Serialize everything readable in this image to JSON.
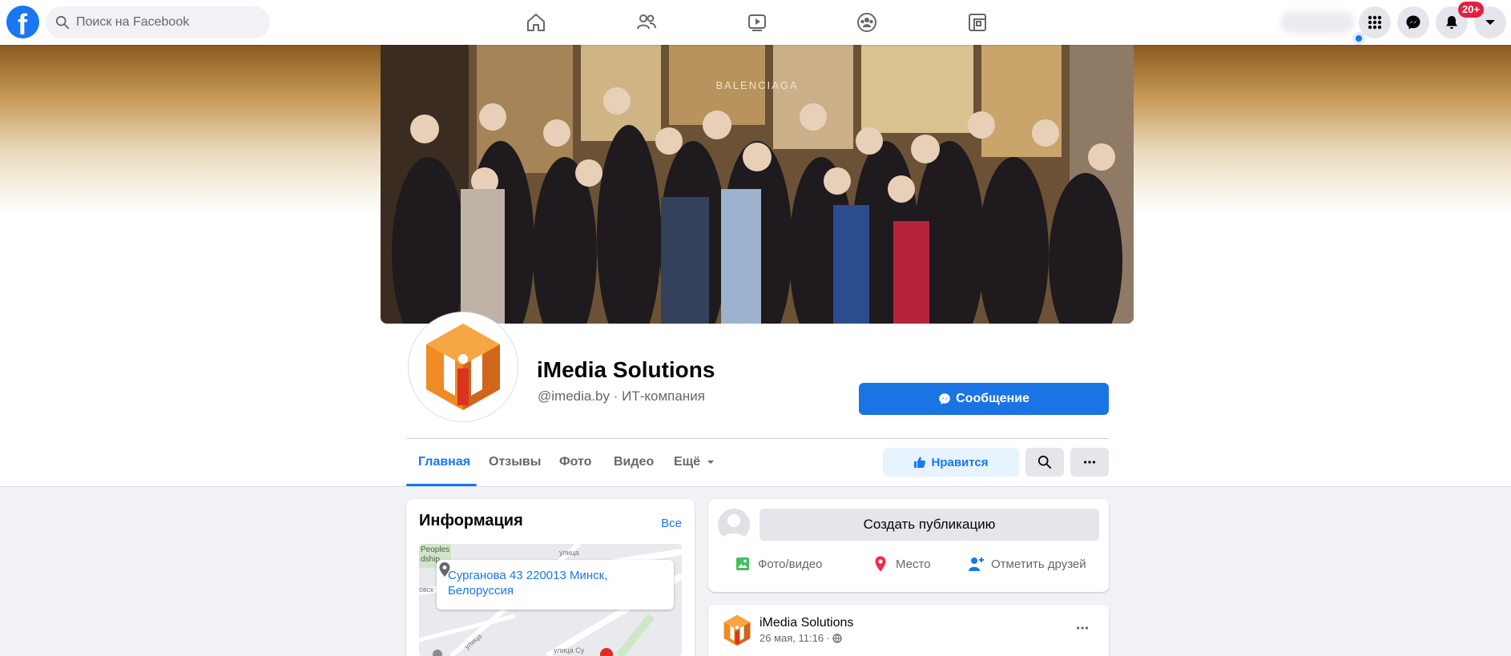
{
  "topbar": {
    "logo_letter": "f",
    "search_placeholder": "Поиск на Facebook",
    "nav_icons": [
      "home-icon",
      "friends-icon",
      "watch-icon",
      "groups-icon",
      "gaming-icon"
    ],
    "right_icons": [
      "menu-grid-icon",
      "messenger-icon",
      "bell-icon",
      "chevron-down-icon"
    ],
    "notifications_badge": "20+",
    "colors": {
      "brand": "#1877f2",
      "badge": "#e41e3f"
    }
  },
  "page": {
    "name": "iMedia Solutions",
    "subtitle": "@imedia.by · ИТ-компания",
    "message_button": "Сообщение",
    "cover_text": "BALENCIAGA"
  },
  "tabs": [
    {
      "label": "Главная",
      "active": true
    },
    {
      "label": "Отзывы",
      "active": false
    },
    {
      "label": "Фото",
      "active": false
    },
    {
      "label": "Видео",
      "active": false
    },
    {
      "label": "Ещё",
      "active": false
    }
  ],
  "actions": {
    "like_label": "Нравится",
    "search_icon": "search-icon",
    "more_icon": "more-icon"
  },
  "info": {
    "title": "Информация",
    "see_all": "Все",
    "address": "Сурганова 43 220013 Минск, Белоруссия",
    "map_labels": [
      "Peoples",
      "dship",
      "улица",
      "овск",
      "улица",
      "улица Су"
    ]
  },
  "composer": {
    "placeholder": "Создать публикацию",
    "actions": [
      {
        "label": "Фото/видео",
        "icon": "photo-icon"
      },
      {
        "label": "Место",
        "icon": "location-pin-icon"
      },
      {
        "label": "Отметить друзей",
        "icon": "tag-friends-icon"
      }
    ]
  },
  "post": {
    "author": "iMedia Solutions",
    "date": "26 мая, 11:16 ·",
    "privacy_icon": "globe-icon"
  }
}
